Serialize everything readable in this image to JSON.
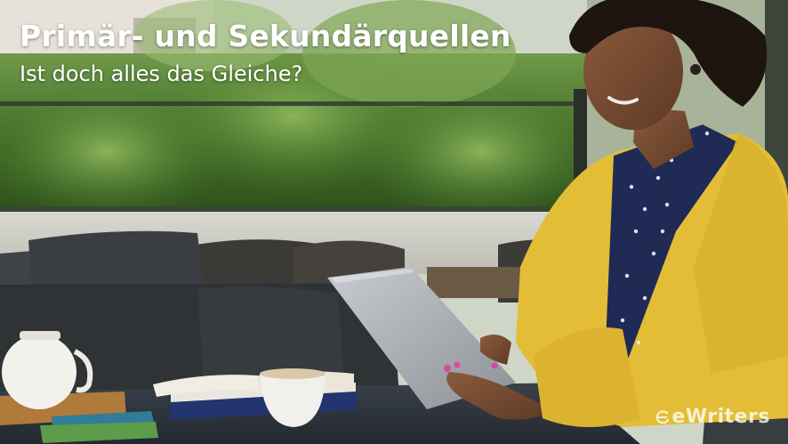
{
  "headline": {
    "title": "Primär- und Sekundärquellen",
    "subtitle": "Ist doch alles das Gleiche?"
  },
  "brand": {
    "name": "eWriters",
    "icon": "ewriters-logo-icon",
    "color": "#ffffff"
  },
  "scene": {
    "description_colors": {
      "foliage": "#4f7a2e",
      "cardigan": "#e8c23a",
      "blouse": "#1f2a55",
      "cushions": "#3a3d40",
      "table": "#2c3138"
    }
  }
}
